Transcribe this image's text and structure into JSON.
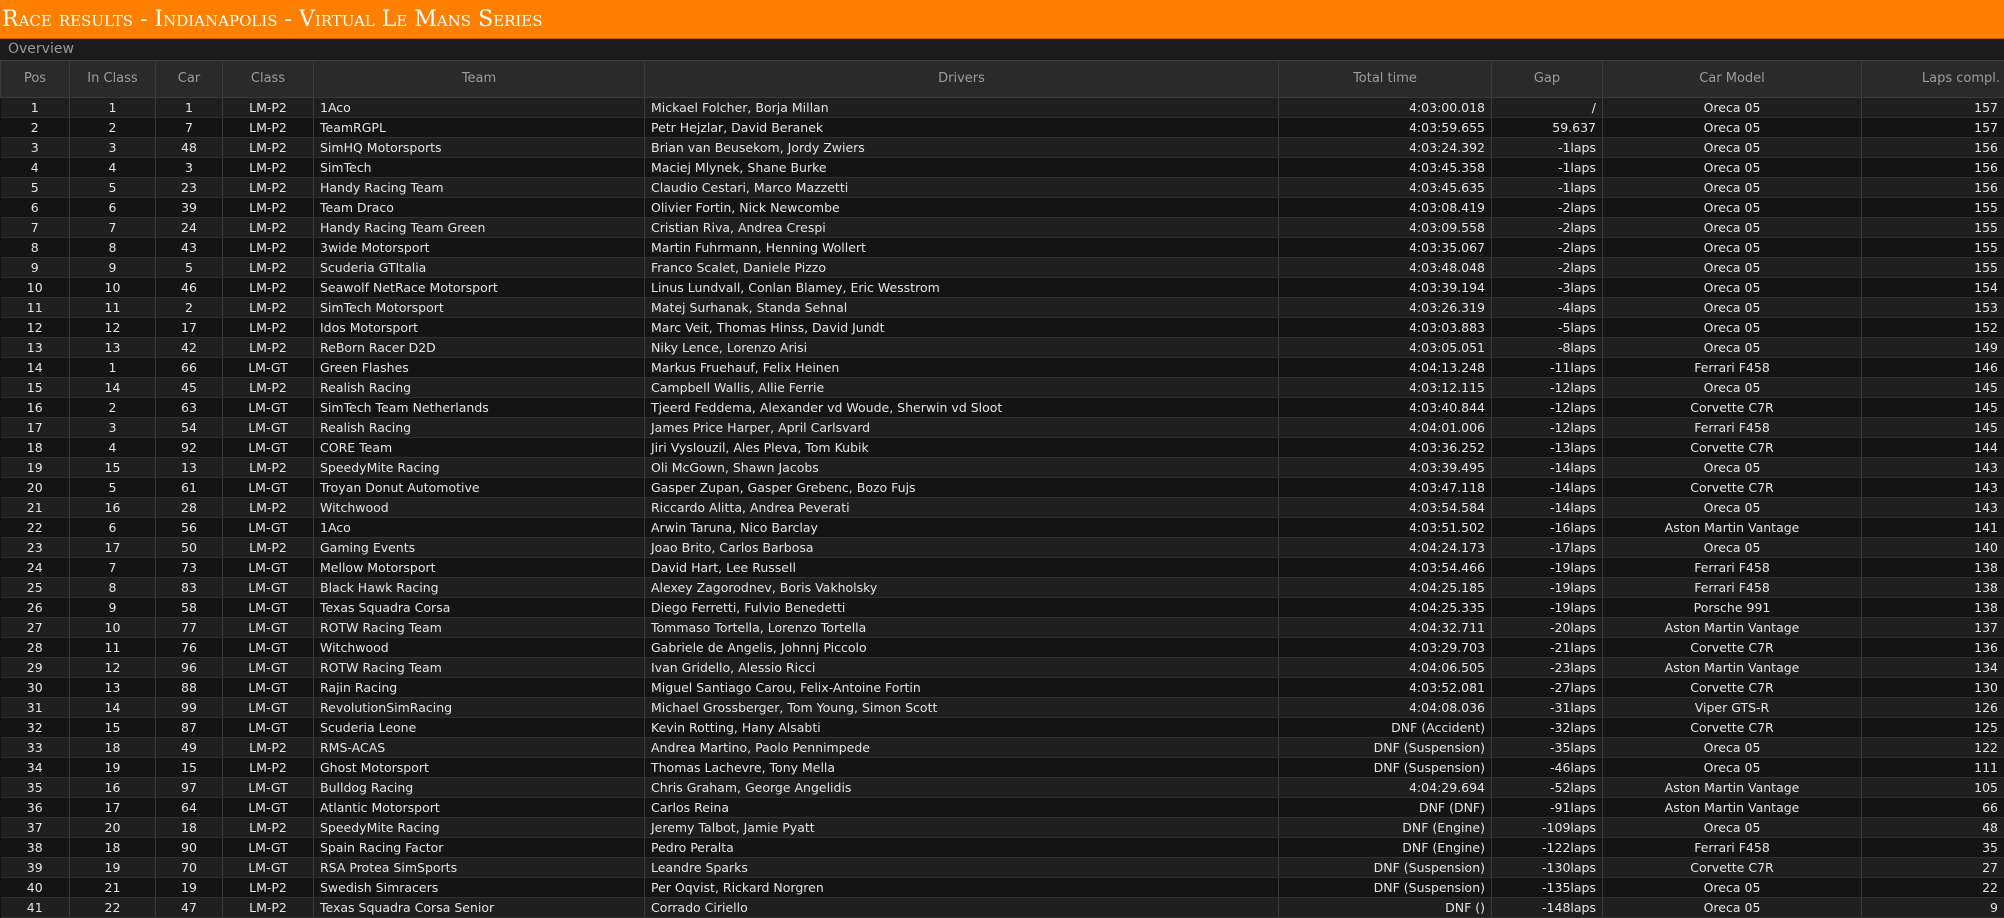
{
  "header": {
    "title": "Race results - Indianapolis - Virtual Le Mans Series",
    "section_label": "Overview"
  },
  "colors": {
    "title_bar": "#ff7f00",
    "background": "#141414",
    "header_row": "#2a2a2a"
  },
  "table": {
    "columns": [
      "Pos",
      "In Class",
      "Car",
      "Class",
      "Team",
      "Drivers",
      "Total time",
      "Gap",
      "Car Model",
      "Laps compl."
    ],
    "rows": [
      [
        "1",
        "1",
        "1",
        "LM-P2",
        "1Aco",
        "Mickael Folcher, Borja Millan",
        "4:03:00.018",
        "/",
        "Oreca 05",
        "157"
      ],
      [
        "2",
        "2",
        "7",
        "LM-P2",
        "TeamRGPL",
        "Petr Hejzlar, David Beranek",
        "4:03:59.655",
        "59.637",
        "Oreca 05",
        "157"
      ],
      [
        "3",
        "3",
        "48",
        "LM-P2",
        "SimHQ Motorsports",
        "Brian van Beusekom, Jordy Zwiers",
        "4:03:24.392",
        "-1laps",
        "Oreca 05",
        "156"
      ],
      [
        "4",
        "4",
        "3",
        "LM-P2",
        "SimTech",
        "Maciej Mlynek, Shane Burke",
        "4:03:45.358",
        "-1laps",
        "Oreca 05",
        "156"
      ],
      [
        "5",
        "5",
        "23",
        "LM-P2",
        "Handy Racing Team",
        "Claudio Cestari, Marco Mazzetti",
        "4:03:45.635",
        "-1laps",
        "Oreca 05",
        "156"
      ],
      [
        "6",
        "6",
        "39",
        "LM-P2",
        "Team Draco",
        "Olivier Fortin, Nick Newcombe",
        "4:03:08.419",
        "-2laps",
        "Oreca 05",
        "155"
      ],
      [
        "7",
        "7",
        "24",
        "LM-P2",
        "Handy Racing Team Green",
        "Cristian Riva, Andrea Crespi",
        "4:03:09.558",
        "-2laps",
        "Oreca 05",
        "155"
      ],
      [
        "8",
        "8",
        "43",
        "LM-P2",
        "3wide Motorsport",
        "Martin Fuhrmann, Henning Wollert",
        "4:03:35.067",
        "-2laps",
        "Oreca 05",
        "155"
      ],
      [
        "9",
        "9",
        "5",
        "LM-P2",
        "Scuderia GTItalia",
        "Franco Scalet, Daniele Pizzo",
        "4:03:48.048",
        "-2laps",
        "Oreca 05",
        "155"
      ],
      [
        "10",
        "10",
        "46",
        "LM-P2",
        "Seawolf NetRace Motorsport",
        "Linus Lundvall, Conlan Blamey, Eric Wesstrom",
        "4:03:39.194",
        "-3laps",
        "Oreca 05",
        "154"
      ],
      [
        "11",
        "11",
        "2",
        "LM-P2",
        "SimTech Motorsport",
        "Matej Surhanak, Standa Sehnal",
        "4:03:26.319",
        "-4laps",
        "Oreca 05",
        "153"
      ],
      [
        "12",
        "12",
        "17",
        "LM-P2",
        "Idos Motorsport",
        "Marc Veit, Thomas Hinss, David Jundt",
        "4:03:03.883",
        "-5laps",
        "Oreca 05",
        "152"
      ],
      [
        "13",
        "13",
        "42",
        "LM-P2",
        "ReBorn Racer D2D",
        "Niky Lence, Lorenzo Arisi",
        "4:03:05.051",
        "-8laps",
        "Oreca 05",
        "149"
      ],
      [
        "14",
        "1",
        "66",
        "LM-GT",
        "Green Flashes",
        "Markus Fruehauf, Felix Heinen",
        "4:04:13.248",
        "-11laps",
        "Ferrari F458",
        "146"
      ],
      [
        "15",
        "14",
        "45",
        "LM-P2",
        "Realish Racing",
        "Campbell Wallis, Allie Ferrie",
        "4:03:12.115",
        "-12laps",
        "Oreca 05",
        "145"
      ],
      [
        "16",
        "2",
        "63",
        "LM-GT",
        "SimTech Team Netherlands",
        "Tjeerd Feddema, Alexander vd Woude, Sherwin vd Sloot",
        "4:03:40.844",
        "-12laps",
        "Corvette C7R",
        "145"
      ],
      [
        "17",
        "3",
        "54",
        "LM-GT",
        "Realish Racing",
        "James Price Harper, April Carlsvard",
        "4:04:01.006",
        "-12laps",
        "Ferrari F458",
        "145"
      ],
      [
        "18",
        "4",
        "92",
        "LM-GT",
        "CORE Team",
        "Jiri Vyslouzil, Ales Pleva, Tom Kubik",
        "4:03:36.252",
        "-13laps",
        "Corvette C7R",
        "144"
      ],
      [
        "19",
        "15",
        "13",
        "LM-P2",
        "SpeedyMite Racing",
        "Oli McGown, Shawn Jacobs",
        "4:03:39.495",
        "-14laps",
        "Oreca 05",
        "143"
      ],
      [
        "20",
        "5",
        "61",
        "LM-GT",
        "Troyan Donut Automotive",
        "Gasper Zupan, Gasper Grebenc, Bozo Fujs",
        "4:03:47.118",
        "-14laps",
        "Corvette C7R",
        "143"
      ],
      [
        "21",
        "16",
        "28",
        "LM-P2",
        "Witchwood",
        "Riccardo Alitta, Andrea Peverati",
        "4:03:54.584",
        "-14laps",
        "Oreca 05",
        "143"
      ],
      [
        "22",
        "6",
        "56",
        "LM-GT",
        "1Aco",
        "Arwin Taruna, Nico Barclay",
        "4:03:51.502",
        "-16laps",
        "Aston Martin Vantage",
        "141"
      ],
      [
        "23",
        "17",
        "50",
        "LM-P2",
        "Gaming Events",
        "Joao Brito, Carlos Barbosa",
        "4:04:24.173",
        "-17laps",
        "Oreca 05",
        "140"
      ],
      [
        "24",
        "7",
        "73",
        "LM-GT",
        "Mellow Motorsport",
        "David Hart, Lee Russell",
        "4:03:54.466",
        "-19laps",
        "Ferrari F458",
        "138"
      ],
      [
        "25",
        "8",
        "83",
        "LM-GT",
        "Black Hawk Racing",
        "Alexey Zagorodnev, Boris Vakholsky",
        "4:04:25.185",
        "-19laps",
        "Ferrari F458",
        "138"
      ],
      [
        "26",
        "9",
        "58",
        "LM-GT",
        "Texas Squadra Corsa",
        "Diego Ferretti, Fulvio Benedetti",
        "4:04:25.335",
        "-19laps",
        "Porsche 991",
        "138"
      ],
      [
        "27",
        "10",
        "77",
        "LM-GT",
        "ROTW Racing Team",
        "Tommaso Tortella, Lorenzo Tortella",
        "4:04:32.711",
        "-20laps",
        "Aston Martin Vantage",
        "137"
      ],
      [
        "28",
        "11",
        "76",
        "LM-GT",
        "Witchwood",
        "Gabriele de Angelis, Johnnj Piccolo",
        "4:03:29.703",
        "-21laps",
        "Corvette C7R",
        "136"
      ],
      [
        "29",
        "12",
        "96",
        "LM-GT",
        "ROTW Racing Team",
        "Ivan Gridello, Alessio Ricci",
        "4:04:06.505",
        "-23laps",
        "Aston Martin Vantage",
        "134"
      ],
      [
        "30",
        "13",
        "88",
        "LM-GT",
        "Rajin Racing",
        "Miguel Santiago Carou, Felix-Antoine Fortin",
        "4:03:52.081",
        "-27laps",
        "Corvette C7R",
        "130"
      ],
      [
        "31",
        "14",
        "99",
        "LM-GT",
        "RevolutionSimRacing",
        "Michael Grossberger, Tom Young, Simon Scott",
        "4:04:08.036",
        "-31laps",
        "Viper GTS-R",
        "126"
      ],
      [
        "32",
        "15",
        "87",
        "LM-GT",
        "Scuderia Leone",
        "Kevin Rotting, Hany Alsabti",
        "DNF (Accident)",
        "-32laps",
        "Corvette C7R",
        "125"
      ],
      [
        "33",
        "18",
        "49",
        "LM-P2",
        "RMS-ACAS",
        "Andrea Martino, Paolo Pennimpede",
        "DNF (Suspension)",
        "-35laps",
        "Oreca 05",
        "122"
      ],
      [
        "34",
        "19",
        "15",
        "LM-P2",
        "Ghost Motorsport",
        "Thomas Lachevre, Tony Mella",
        "DNF (Suspension)",
        "-46laps",
        "Oreca 05",
        "111"
      ],
      [
        "35",
        "16",
        "97",
        "LM-GT",
        "Bulldog Racing",
        "Chris Graham, George Angelidis",
        "4:04:29.694",
        "-52laps",
        "Aston Martin Vantage",
        "105"
      ],
      [
        "36",
        "17",
        "64",
        "LM-GT",
        "Atlantic Motorsport",
        "Carlos Reina",
        "DNF (DNF)",
        "-91laps",
        "Aston Martin Vantage",
        "66"
      ],
      [
        "37",
        "20",
        "18",
        "LM-P2",
        "SpeedyMite Racing",
        "Jeremy Talbot, Jamie Pyatt",
        "DNF (Engine)",
        "-109laps",
        "Oreca 05",
        "48"
      ],
      [
        "38",
        "18",
        "90",
        "LM-GT",
        "Spain Racing Factor",
        "Pedro Peralta",
        "DNF (Engine)",
        "-122laps",
        "Ferrari F458",
        "35"
      ],
      [
        "39",
        "19",
        "70",
        "LM-GT",
        "RSA Protea SimSports",
        "Leandre Sparks",
        "DNF (Suspension)",
        "-130laps",
        "Corvette C7R",
        "27"
      ],
      [
        "40",
        "21",
        "19",
        "LM-P2",
        "Swedish Simracers",
        "Per Oqvist, Rickard Norgren",
        "DNF (Suspension)",
        "-135laps",
        "Oreca 05",
        "22"
      ],
      [
        "41",
        "22",
        "47",
        "LM-P2",
        "Texas Squadra Corsa Senior",
        "Corrado Ciriello",
        "DNF ()",
        "-148laps",
        "Oreca 05",
        "9"
      ]
    ]
  }
}
